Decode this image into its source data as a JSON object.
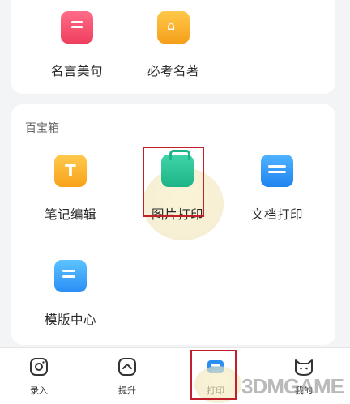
{
  "top_section": {
    "items": [
      {
        "label": "名言美句",
        "icon": "quote-icon",
        "color": "#ef3f5f"
      },
      {
        "label": "必考名著",
        "icon": "book-icon",
        "color": "#f59f1a"
      }
    ]
  },
  "toolbox": {
    "title": "百宝箱",
    "items": [
      {
        "label": "笔记编辑",
        "icon": "note-edit-icon",
        "glyph": "T",
        "color": "#f7a21a"
      },
      {
        "label": "图片打印",
        "icon": "image-print-icon",
        "color": "#1fb488"
      },
      {
        "label": "文档打印",
        "icon": "document-print-icon",
        "color": "#1f84f0"
      },
      {
        "label": "模版中心",
        "icon": "template-center-icon",
        "color": "#2a8ef5"
      }
    ]
  },
  "tabbar": {
    "tabs": [
      {
        "label": "录入",
        "icon": "camera-icon"
      },
      {
        "label": "提升",
        "icon": "improve-icon"
      },
      {
        "label": "打印",
        "icon": "print-icon",
        "active": true
      },
      {
        "label": "我的",
        "icon": "profile-cat-icon"
      }
    ]
  },
  "watermark": "3DMGAME",
  "highlight_color": "#c0202a"
}
